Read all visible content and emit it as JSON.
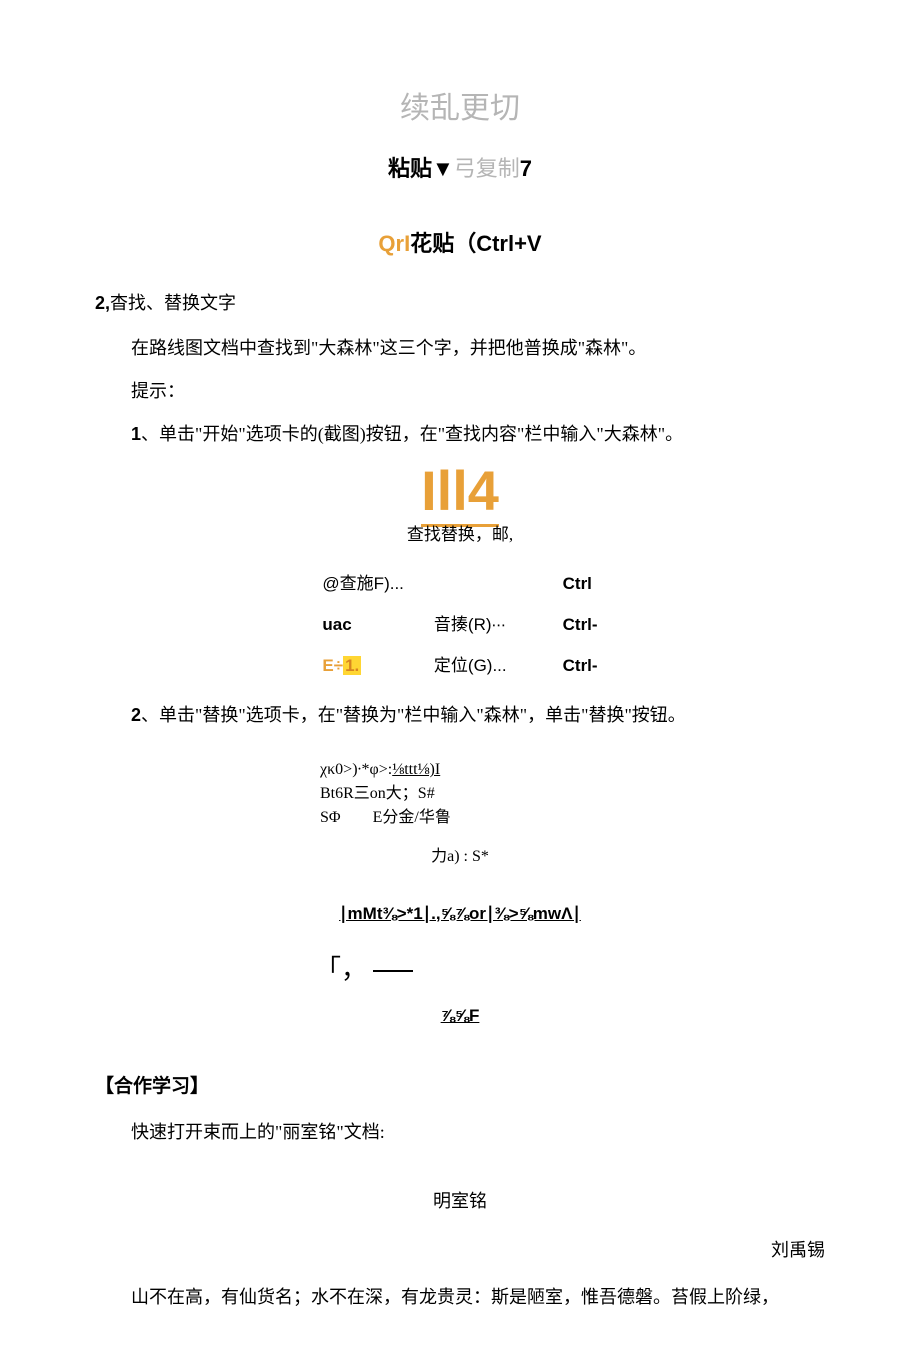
{
  "header": {
    "gray_title": "续乱更切",
    "sub_black1": "粘贴▼",
    "sub_gray": "弓复制",
    "sub_black2": "7",
    "qri_orange": "QrI",
    "qri_black": "花贴（Ctrl+V"
  },
  "section2": {
    "num": "2,",
    "title": "杳找、替换文字",
    "step_intro": "在路线图文档中查找到\"大森林\"这三个字，并把他普换成\"森林\"。",
    "hint_label": "提示：",
    "step1_num": "1",
    "step1_text": "、单击\"开始\"选项卡的(截图)按钮，在\"查找内容\"栏中输入\"大森林\"。",
    "big_icon": "Ill4",
    "find_replace_label": "查找替换，邮,",
    "menu": {
      "row1": {
        "left": "@查施F)...",
        "right": "Ctrl"
      },
      "row2": {
        "prefix": "uac",
        "mid": "音揍(R)∙∙∙",
        "right": "Ctrl-"
      },
      "row3": {
        "e": "E÷",
        "one": "1.",
        "mid": " 定位(G)...",
        "right": "Ctrl-"
      }
    },
    "step2_num": "2",
    "step2_text": "、单击\"替换\"选项卡，在\"替换为\"栏中输入\"森林\"，单击\"替换\"按钮。"
  },
  "garble": {
    "l1": "χκ0>)∙*φ>:⅛ttt⅛)I",
    "l2": "Bt6R三on大；S#",
    "l3a": "SΦ",
    "l3b": "E分金/华鲁",
    "l4": "力a) : S*",
    "bold_under": "∣mMt⅜>*1∣.,⅝⅞or∣⅜>⅝mwΛ∣",
    "bracket": "「，",
    "fract": "⅞⅝F"
  },
  "coop": {
    "heading": "【合作学习】",
    "open_doc": "快速打开束而上的\"丽室铭\"文档:",
    "doc_title": "明室铭",
    "author": "刘禹锡",
    "body": "山不在高，有仙货名；水不在深，有龙贵灵：斯是陋室，惟吾德磐。苔假上阶绿，"
  }
}
